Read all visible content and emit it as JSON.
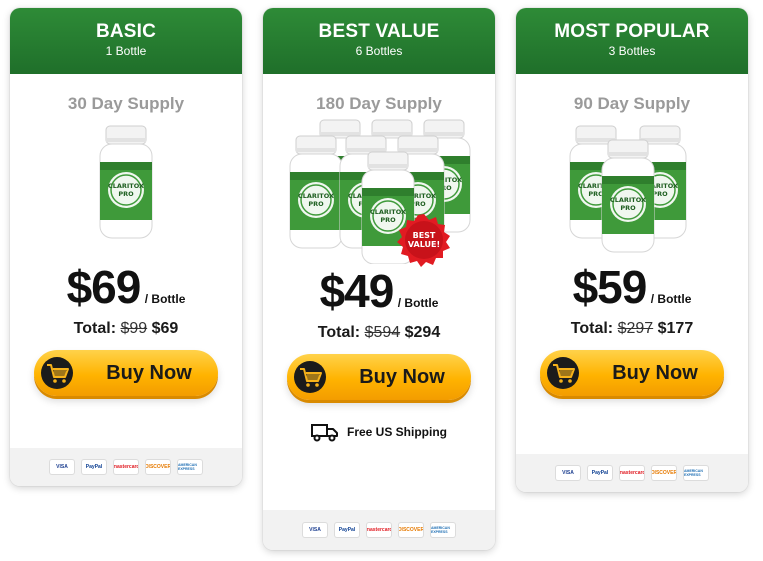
{
  "plans": [
    {
      "title": "BASIC",
      "subtitle": "1 Bottle",
      "supply": "30 Day Supply",
      "price": "$69",
      "per": "/ Bottle",
      "total_label": "Total:",
      "old_total": "$99",
      "new_total": "$69",
      "cta": "Buy Now",
      "product_image": "1-bottle-icon"
    },
    {
      "title": "BEST VALUE",
      "subtitle": "6 Bottles",
      "supply": "180 Day Supply",
      "price": "$49",
      "per": "/ Bottle",
      "total_label": "Total:",
      "old_total": "$594",
      "new_total": "$294",
      "cta": "Buy Now",
      "shipping": "Free US Shipping",
      "badge": "BEST VALUE!",
      "product_image": "6-bottles-icon"
    },
    {
      "title": "MOST POPULAR",
      "subtitle": "3 Bottles",
      "supply": "90 Day Supply",
      "price": "$59",
      "per": "/ Bottle",
      "total_label": "Total:",
      "old_total": "$297",
      "new_total": "$177",
      "cta": "Buy Now",
      "product_image": "3-bottles-icon"
    }
  ],
  "product_name": "CLARITOX PRO",
  "payments": [
    "VISA",
    "PayPal",
    "mastercard",
    "DISCOVER",
    "AMERICAN EXPRESS"
  ],
  "colors": {
    "header_green": "#2e8b37",
    "button_orange": "#ffb300",
    "badge_red": "#e11b22"
  }
}
